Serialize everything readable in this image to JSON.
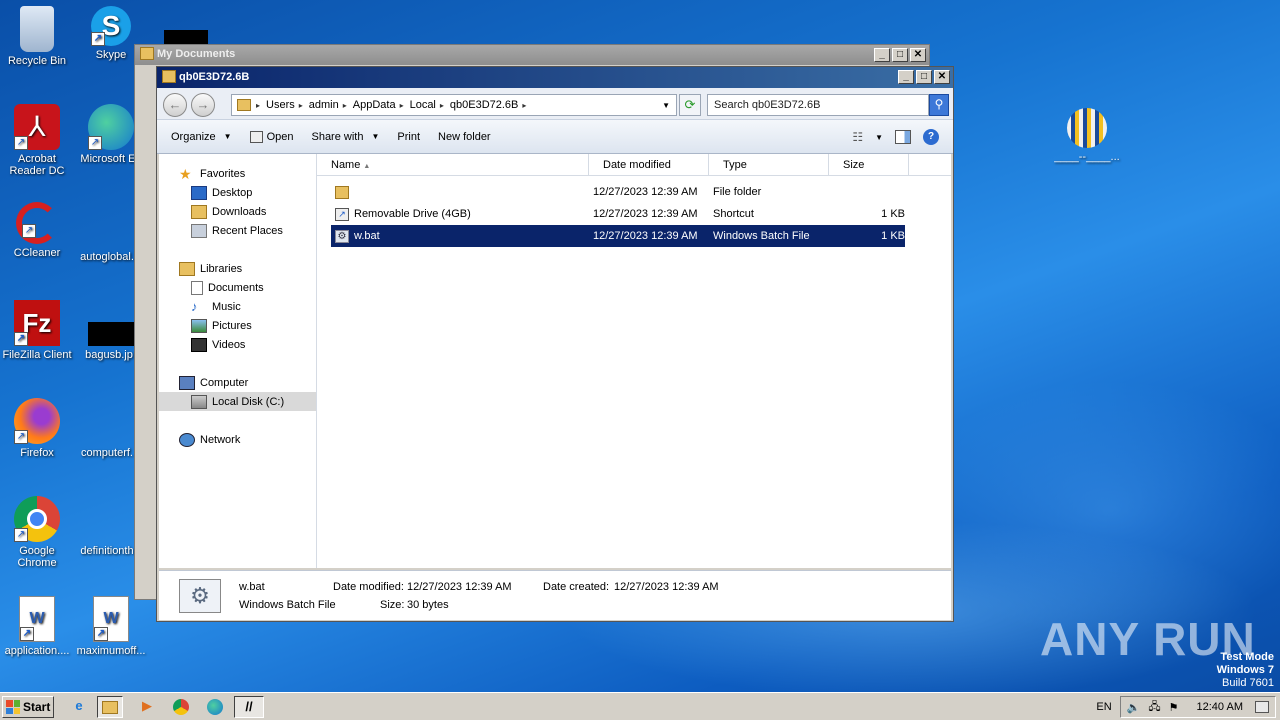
{
  "desktop": {
    "icons": [
      {
        "label": "Recycle Bin",
        "icon": "recycle-bin-icon"
      },
      {
        "label": "Skype",
        "icon": "skype-icon"
      },
      {
        "label": "Acrobat Reader DC",
        "icon": "acrobat-icon"
      },
      {
        "label": "Microsoft Ed",
        "icon": "edge-icon"
      },
      {
        "label": "CCleaner",
        "icon": "ccleaner-icon"
      },
      {
        "label": "autoglobal.",
        "icon": "file-icon"
      },
      {
        "label": "FileZilla Client",
        "icon": "filezilla-icon"
      },
      {
        "label": "bagusb.jp",
        "icon": "image-file-icon"
      },
      {
        "label": "Firefox",
        "icon": "firefox-icon"
      },
      {
        "label": "computerf.",
        "icon": "file-icon"
      },
      {
        "label": "Google Chrome",
        "icon": "chrome-icon"
      },
      {
        "label": "definitionth",
        "icon": "file-icon"
      },
      {
        "label": "application....",
        "icon": "word-doc-icon"
      },
      {
        "label": "maximumoff...",
        "icon": "word-doc-icon"
      },
      {
        "label": "____--____...",
        "icon": "shield-exe-icon"
      }
    ]
  },
  "back_window": {
    "title": "My Documents"
  },
  "window": {
    "title": "qb0E3D72.6B",
    "address": [
      "Users",
      "admin",
      "AppData",
      "Local",
      "qb0E3D72.6B"
    ],
    "search_placeholder": "Search qb0E3D72.6B",
    "toolbar": {
      "organize": "Organize",
      "open": "Open",
      "share_with": "Share with",
      "print": "Print",
      "new_folder": "New folder"
    },
    "nav": {
      "favorites": "Favorites",
      "desktop": "Desktop",
      "downloads": "Downloads",
      "recent": "Recent Places",
      "libraries": "Libraries",
      "documents": "Documents",
      "music": "Music",
      "pictures": "Pictures",
      "videos": "Videos",
      "computer": "Computer",
      "local_disk": "Local Disk (C:)",
      "network": "Network"
    },
    "columns": {
      "name": "Name",
      "date": "Date modified",
      "type": "Type",
      "size": "Size"
    },
    "files": [
      {
        "name": "",
        "date": "12/27/2023 12:39 AM",
        "type": "File folder",
        "size": ""
      },
      {
        "name": "Removable Drive (4GB)",
        "date": "12/27/2023 12:39 AM",
        "type": "Shortcut",
        "size": "1 KB"
      },
      {
        "name": "w.bat",
        "date": "12/27/2023 12:39 AM",
        "type": "Windows Batch File",
        "size": "1 KB"
      }
    ],
    "details": {
      "name": "w.bat",
      "type": "Windows Batch File",
      "modified_label": "Date modified:",
      "modified": "12/27/2023 12:39 AM",
      "created_label": "Date created:",
      "created": "12/27/2023 12:39 AM",
      "size_label": "Size:",
      "size": "30 bytes"
    }
  },
  "taskbar": {
    "start": "Start",
    "lang": "EN",
    "clock": "12:40 AM"
  },
  "watermark": {
    "line1": "Test Mode",
    "line2": "Windows 7",
    "line3": "Build 7601",
    "brand": "ANY RUN"
  },
  "colors": {
    "selection": "#0a246a",
    "desktop": "#1673d0",
    "title_active": "#0a246a"
  }
}
